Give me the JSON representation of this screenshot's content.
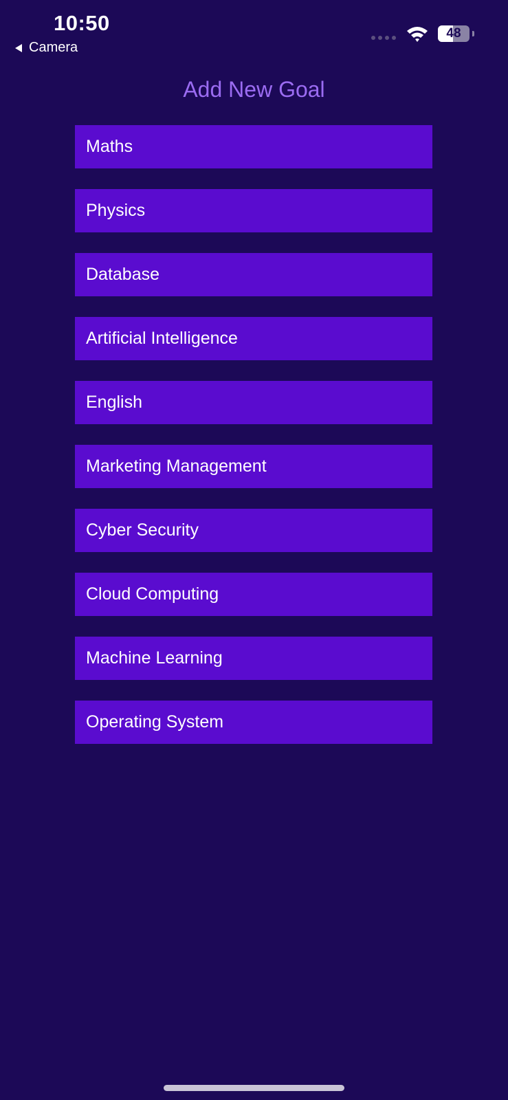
{
  "status_bar": {
    "time": "10:50",
    "back_label": "Camera",
    "battery_level": "48",
    "battery_fraction": 0.48,
    "icons": [
      "back-arrow-icon",
      "signal-icon",
      "wifi-icon",
      "battery-icon"
    ]
  },
  "page": {
    "title": "Add New Goal"
  },
  "goals": [
    {
      "label": "Maths"
    },
    {
      "label": "Physics"
    },
    {
      "label": "Database"
    },
    {
      "label": "Artificial Intelligence"
    },
    {
      "label": "English"
    },
    {
      "label": "Marketing Management"
    },
    {
      "label": "Cyber Security"
    },
    {
      "label": "Cloud Computing"
    },
    {
      "label": "Machine Learning"
    },
    {
      "label": "Operating System"
    }
  ],
  "colors": {
    "background": "#1c0957",
    "item_background": "#5a0ccf",
    "title": "#9b6cf2",
    "item_text": "#ffffff"
  }
}
